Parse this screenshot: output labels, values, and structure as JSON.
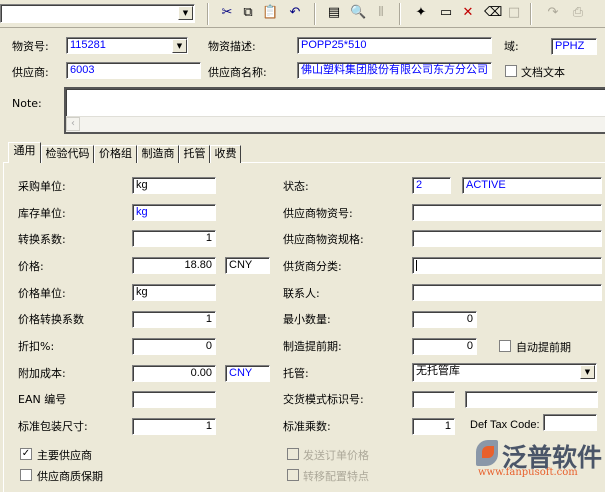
{
  "toolbar": {
    "combo_value": "",
    "icons": [
      "cut-icon",
      "copy-icon",
      "paste-icon",
      "undo-icon",
      "properties-icon",
      "search-icon",
      "attach-icon",
      "new-icon",
      "open-icon",
      "delete-icon",
      "erase-icon",
      "blank-icon",
      "redo-icon",
      "print-icon"
    ]
  },
  "header": {
    "item_no_label": "物资号:",
    "item_no": "115281",
    "desc_label": "物资描述:",
    "desc": "POPP25*510",
    "domain_label": "域:",
    "domain": "PPHZ",
    "supplier_label": "供应商:",
    "supplier": "6003",
    "supplier_name_label": "供应商名称:",
    "supplier_name": "佛山塑料集团股份有限公司东方分公司",
    "doc_text_label": "文档文本",
    "note_label": "Note:",
    "note": ""
  },
  "tabs": [
    "通用",
    "检验代码",
    "价格组",
    "制造商",
    "托管",
    "收费"
  ],
  "left": [
    {
      "label": "采购单位:",
      "value": "kg"
    },
    {
      "label": "库存单位:",
      "value": "kg"
    },
    {
      "label": "转换系数:",
      "value": "1"
    },
    {
      "label": "价格:",
      "value": "18.80",
      "currency": "CNY"
    },
    {
      "label": "价格单位:",
      "value": "kg"
    },
    {
      "label": "价格转换系数",
      "value": "1"
    },
    {
      "label": "折扣%:",
      "value": "0"
    },
    {
      "label": "附加成本:",
      "value": "0.00",
      "currency": "CNY"
    },
    {
      "label": "EAN 编号",
      "value": ""
    },
    {
      "label": "标准包装尺寸:",
      "value": "1"
    }
  ],
  "right": {
    "status_label": "状态:",
    "status_code": "2",
    "status_text": "ACTIVE",
    "supplier_item_label": "供应商物资号:",
    "supplier_item": "",
    "supplier_spec_label": "供应商物资规格:",
    "supplier_spec": "",
    "supplier_class_label": "供货商分类:",
    "supplier_class": "",
    "contact_label": "联系人:",
    "contact": "",
    "min_qty_label": "最小数量:",
    "min_qty": "0",
    "mfg_lead_label": "制造提前期:",
    "mfg_lead": "0",
    "auto_lead_label": "自动提前期",
    "consign_label": "托管:",
    "consign": "无托管库",
    "delivery_label": "交货模式标识号:",
    "delivery_a": "",
    "delivery_b": "",
    "multiple_label": "标准乘数:",
    "multiple": "1",
    "tax_label": "Def Tax Code:",
    "tax": ""
  },
  "checks": {
    "main_supplier": {
      "label": "主要供应商",
      "checked": true
    },
    "warranty": {
      "label": "供应商质保期",
      "checked": false
    },
    "send_price": {
      "label": "发送订单价格",
      "checked": false
    },
    "transfer_config": {
      "label": "转移配置特点",
      "checked": false
    }
  },
  "watermark": {
    "brand": "泛普软件",
    "url": "www.fanpusoft.com"
  }
}
